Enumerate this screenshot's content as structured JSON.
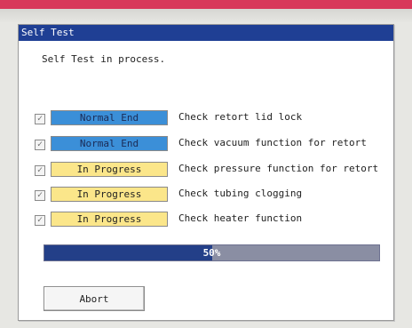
{
  "window": {
    "title": "Self Test",
    "status_text": "Self Test in process."
  },
  "checks": [
    {
      "checked_mark": "✓",
      "status": "Normal End",
      "state": "done",
      "label": "Check retort lid lock"
    },
    {
      "checked_mark": "✓",
      "status": "Normal End",
      "state": "done",
      "label": "Check vacuum function for retort"
    },
    {
      "checked_mark": "✓",
      "status": "In Progress",
      "state": "progress",
      "label": "Check pressure function for retort"
    },
    {
      "checked_mark": "✓",
      "status": "In Progress",
      "state": "progress",
      "label": "Check tubing clogging"
    },
    {
      "checked_mark": "✓",
      "status": "In Progress",
      "state": "progress",
      "label": "Check heater function"
    }
  ],
  "progress": {
    "label": "50%",
    "value": 0.5
  },
  "actions": {
    "abort_label": "Abort"
  },
  "colors": {
    "titlebar": "#1f3f94",
    "done_badge": "#3b8fd8",
    "progress_badge": "#fbe68a",
    "progress_fill": "#233f88",
    "progress_track": "#8a8ea3",
    "top_band": "#d8385a"
  }
}
